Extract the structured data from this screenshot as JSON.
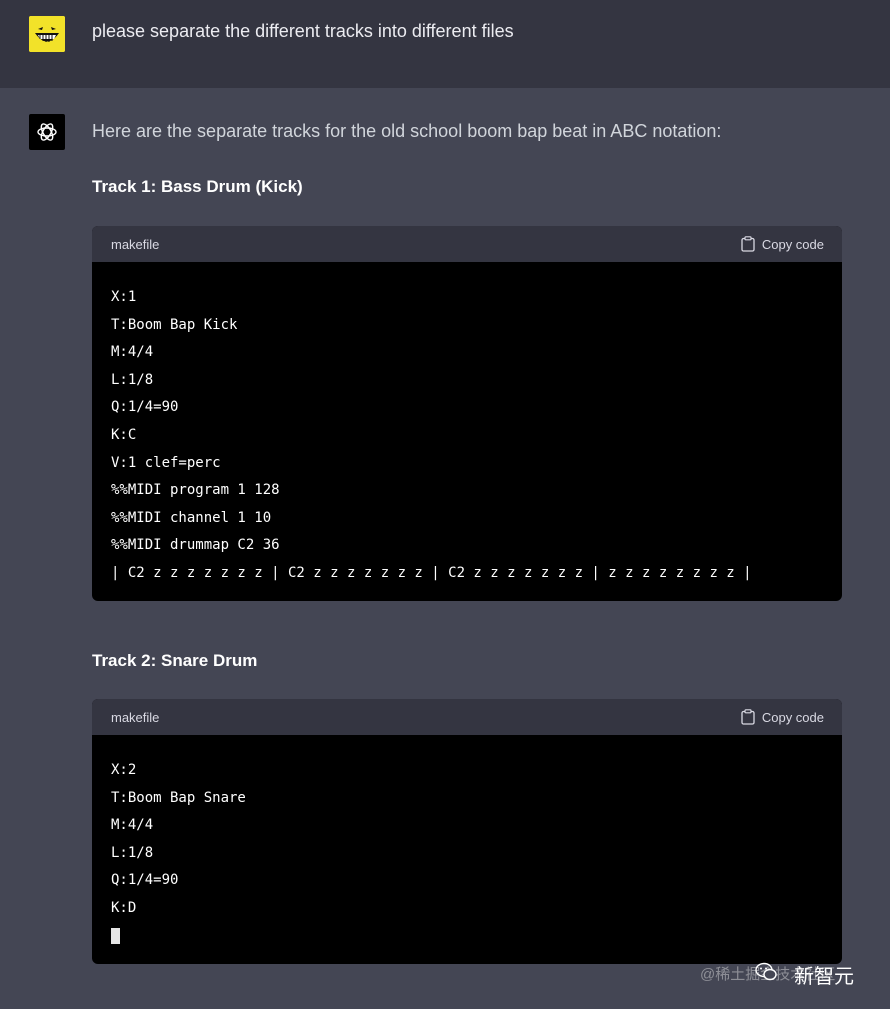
{
  "user_message": {
    "text": "please separate the different tracks into different files"
  },
  "assistant": {
    "intro": "Here are the separate tracks for the old school boom bap beat in ABC notation:",
    "tracks": [
      {
        "heading": "Track 1: Bass Drum (Kick)",
        "language": "makefile",
        "copy_label": "Copy code",
        "lines": [
          "X:1",
          "T:Boom Bap Kick",
          "M:4/4",
          "L:1/8",
          "Q:1/4=90",
          "K:C",
          "V:1 clef=perc",
          "%%MIDI program 1 128",
          "%%MIDI channel 1 10",
          "%%MIDI drummap C2 36",
          "| C2 z z z z z z z | C2 z z z z z z z | C2 z z z z z z z | z z z z z z z z |"
        ]
      },
      {
        "heading": "Track 2: Snare Drum",
        "language": "makefile",
        "copy_label": "Copy code",
        "lines": [
          "X:2",
          "T:Boom Bap Snare",
          "M:4/4",
          "L:1/8",
          "Q:1/4=90",
          "K:D"
        ]
      }
    ]
  },
  "watermark": {
    "sub": "@稀土掘金技术社区",
    "main": "新智元"
  },
  "colors": {
    "user_bg": "#343541",
    "assistant_bg": "#444654",
    "code_bg": "#000000",
    "user_avatar": "#f2e229"
  }
}
